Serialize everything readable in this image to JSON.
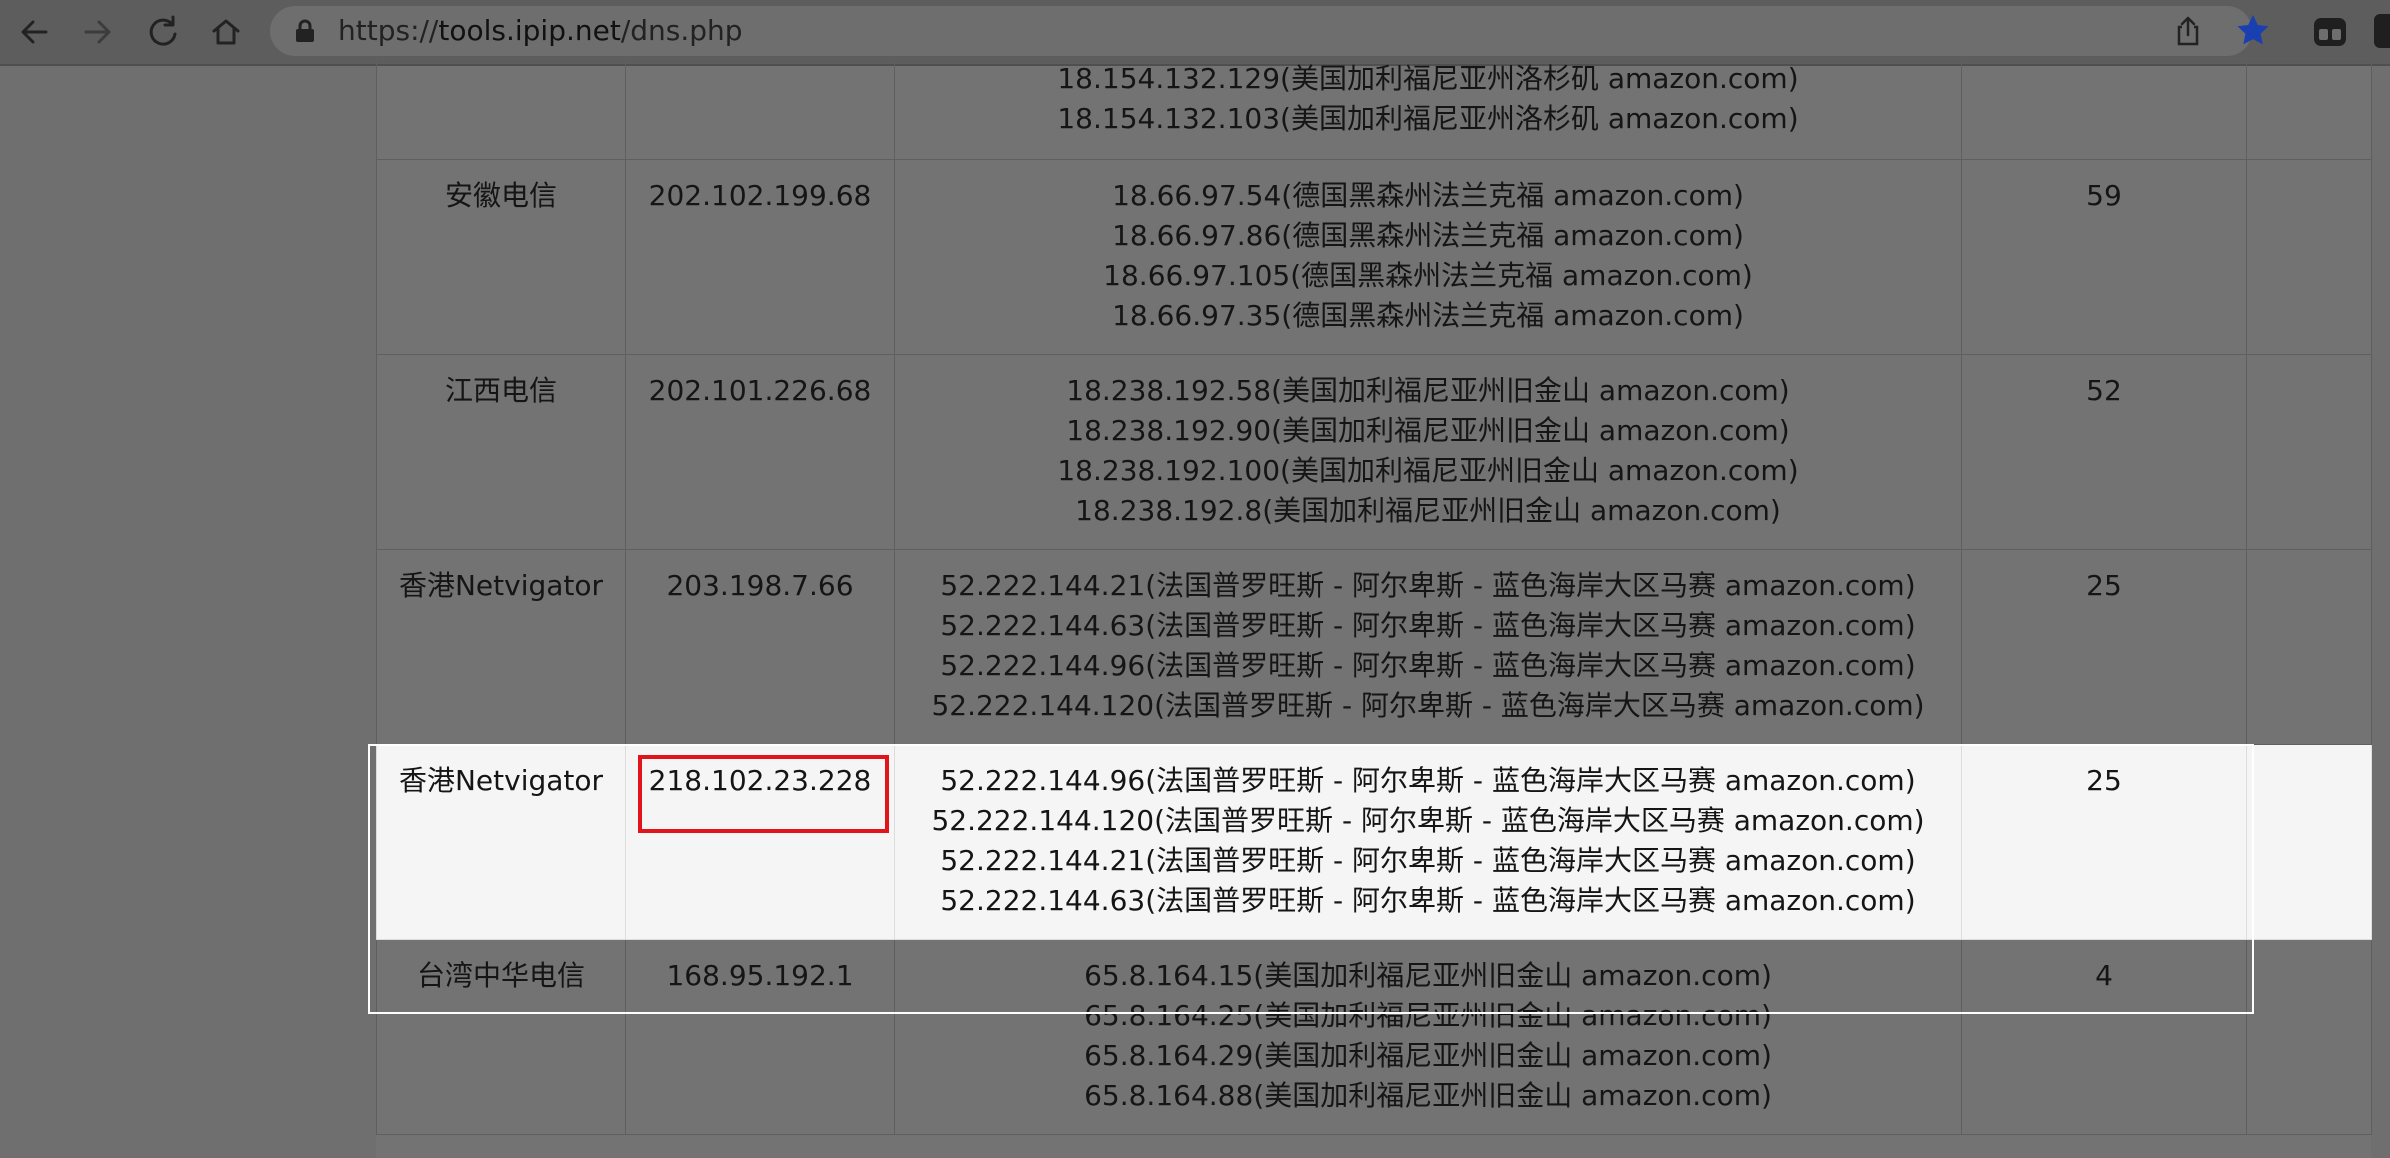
{
  "browser": {
    "url_scheme": "https://",
    "url_host": "tools.ipip.net",
    "url_path": "/dns.php",
    "icons": [
      "back-icon",
      "forward-icon",
      "reload-icon",
      "home-icon",
      "lock-icon",
      "share-icon",
      "bookmark-star-icon",
      "extension-icon"
    ],
    "star_color": "#1a3fb0"
  },
  "table": {
    "rows": [
      {
        "isp": "",
        "dns": "",
        "ips": [
          "18.154.132.129(美国加利福尼亚州洛杉矶 amazon.com)",
          "18.154.132.103(美国加利福尼亚州洛杉矶 amazon.com)"
        ],
        "ttl": ""
      },
      {
        "isp": "安徽电信",
        "dns": "202.102.199.68",
        "ips": [
          "18.66.97.54(德国黑森州法兰克福 amazon.com)",
          "18.66.97.86(德国黑森州法兰克福 amazon.com)",
          "18.66.97.105(德国黑森州法兰克福 amazon.com)",
          "18.66.97.35(德国黑森州法兰克福 amazon.com)"
        ],
        "ttl": "59"
      },
      {
        "isp": "江西电信",
        "dns": "202.101.226.68",
        "ips": [
          "18.238.192.58(美国加利福尼亚州旧金山 amazon.com)",
          "18.238.192.90(美国加利福尼亚州旧金山 amazon.com)",
          "18.238.192.100(美国加利福尼亚州旧金山 amazon.com)",
          "18.238.192.8(美国加利福尼亚州旧金山 amazon.com)"
        ],
        "ttl": "52"
      },
      {
        "isp": "香港Netvigator",
        "dns": "203.198.7.66",
        "ips": [
          "52.222.144.21(法国普罗旺斯 - 阿尔卑斯 - 蓝色海岸大区马赛 amazon.com)",
          "52.222.144.63(法国普罗旺斯 - 阿尔卑斯 - 蓝色海岸大区马赛 amazon.com)",
          "52.222.144.96(法国普罗旺斯 - 阿尔卑斯 - 蓝色海岸大区马赛 amazon.com)",
          "52.222.144.120(法国普罗旺斯 - 阿尔卑斯 - 蓝色海岸大区马赛 amazon.com)"
        ],
        "ttl": "25"
      },
      {
        "isp": "香港Netvigator",
        "dns": "218.102.23.228",
        "ips": [
          "52.222.144.96(法国普罗旺斯 - 阿尔卑斯 - 蓝色海岸大区马赛 amazon.com)",
          "52.222.144.120(法国普罗旺斯 - 阿尔卑斯 - 蓝色海岸大区马赛 amazon.com)",
          "52.222.144.21(法国普罗旺斯 - 阿尔卑斯 - 蓝色海岸大区马赛 amazon.com)",
          "52.222.144.63(法国普罗旺斯 - 阿尔卑斯 - 蓝色海岸大区马赛 amazon.com)"
        ],
        "ttl": "25",
        "highlighted": true
      },
      {
        "isp": "台湾中华电信",
        "dns": "168.95.192.1",
        "ips": [
          "65.8.164.15(美国加利福尼亚州旧金山 amazon.com)",
          "65.8.164.25(美国加利福尼亚州旧金山 amazon.com)",
          "65.8.164.29(美国加利福尼亚州旧金山 amazon.com)",
          "65.8.164.88(美国加利福尼亚州旧金山 amazon.com)"
        ],
        "ttl": "4"
      }
    ]
  },
  "highlight_color": "#e0141a"
}
